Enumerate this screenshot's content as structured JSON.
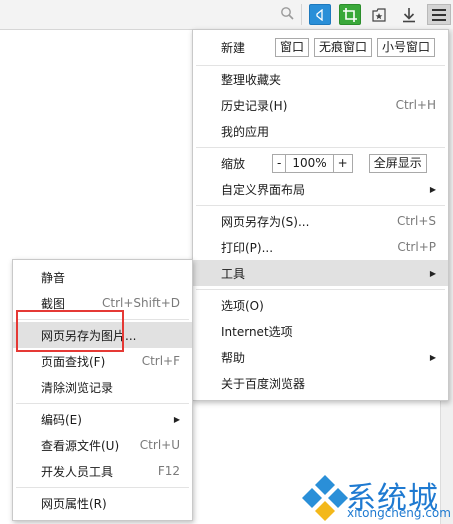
{
  "toolbar": {
    "icons": [
      "search-icon",
      "sound-icon",
      "crop-icon",
      "favorite-icon",
      "download-icon",
      "menu-icon"
    ]
  },
  "main_menu": {
    "new": {
      "label": "新建",
      "window": "窗口",
      "incognito": "无痕窗口",
      "small": "小号窗口"
    },
    "bookmarks": "整理收藏夹",
    "history": {
      "label": "历史记录(H)",
      "shortcut": "Ctrl+H"
    },
    "my_apps": "我的应用",
    "zoom": {
      "label": "缩放",
      "minus": "-",
      "value": "100%",
      "plus": "+",
      "fullscreen": "全屏显示"
    },
    "custom_layout": "自定义界面布局",
    "save_as": {
      "label": "网页另存为(S)...",
      "shortcut": "Ctrl+S"
    },
    "print": {
      "label": "打印(P)...",
      "shortcut": "Ctrl+P"
    },
    "tools": "工具",
    "options": "选项(O)",
    "internet_options": "Internet选项",
    "help": "帮助",
    "about": "关于百度浏览器"
  },
  "sub_menu": {
    "mute": "静音",
    "screenshot": {
      "label": "截图",
      "shortcut": "Ctrl+Shift+D"
    },
    "save_image": "网页另存为图片...",
    "find": {
      "label": "页面查找(F)",
      "shortcut": "Ctrl+F"
    },
    "clear_history": "清除浏览记录",
    "encoding": "编码(E)",
    "view_source": {
      "label": "查看源文件(U)",
      "shortcut": "Ctrl+U"
    },
    "dev_tools": {
      "label": "开发人员工具",
      "shortcut": "F12"
    },
    "properties": "网页属性(R)"
  },
  "watermark": {
    "brand": "系统城",
    "url": "xitongcheng.com"
  },
  "colors": {
    "highlight": "#e1e1e1",
    "callout": "#e53935",
    "sound_btn": "#2a8fd8",
    "crop_btn": "#3aa83a",
    "watermark": "#1f7ad1"
  }
}
